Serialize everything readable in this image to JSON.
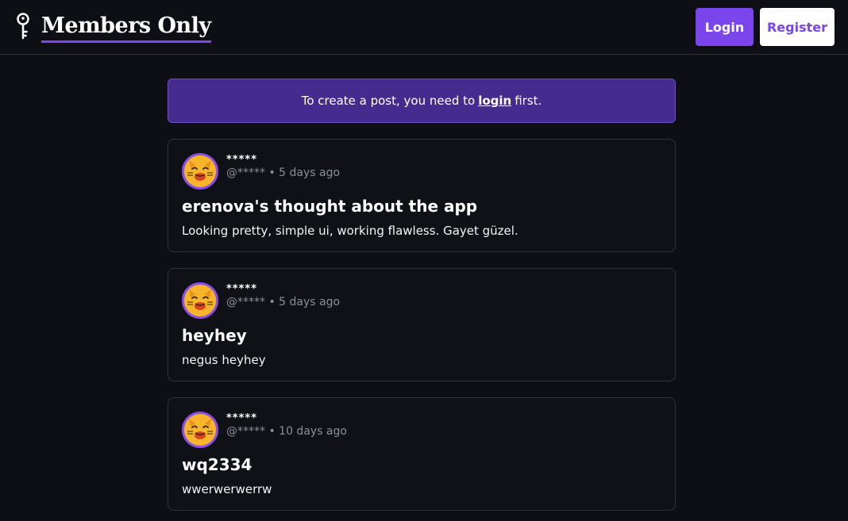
{
  "header": {
    "brand_title": "Members Only",
    "login_label": "Login",
    "register_label": "Register"
  },
  "notice": {
    "before": "To create a post, you need to",
    "link": "login",
    "after": "first."
  },
  "posts": [
    {
      "author": "*****",
      "handle": "@*****",
      "separator": "•",
      "time": "5 days ago",
      "title": "erenova's thought about the app",
      "body": "Looking pretty, simple ui, working flawless. Gayet güzel."
    },
    {
      "author": "*****",
      "handle": "@*****",
      "separator": "•",
      "time": "5 days ago",
      "title": "heyhey",
      "body": "negus heyhey"
    },
    {
      "author": "*****",
      "handle": "@*****",
      "separator": "•",
      "time": "10 days ago",
      "title": "wq2334",
      "body": "wwerwerwerrw"
    }
  ],
  "colors": {
    "background": "#0d0f14",
    "accent": "#7a45ea",
    "notice_bg": "#452b8e"
  },
  "icons": {
    "brand": "key-icon",
    "avatar": "smiling-cat-avatar"
  }
}
